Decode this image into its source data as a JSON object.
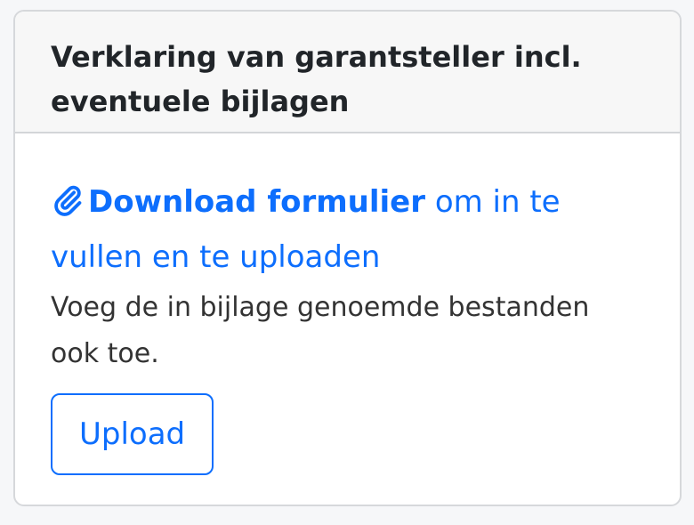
{
  "card": {
    "title": "Verklaring van garantsteller incl. eventuele bijlagen",
    "download_link_label": "Download formulier",
    "download_suffix": " om in te vullen en te uploaden",
    "note": "Voeg de in bijlage genoemde bestanden ook toe.",
    "upload_label": "Upload",
    "download_icon": "paperclip-icon"
  },
  "colors": {
    "accent": "#0d6efd",
    "header_bg": "#f7f7f7",
    "text": "#212529"
  }
}
